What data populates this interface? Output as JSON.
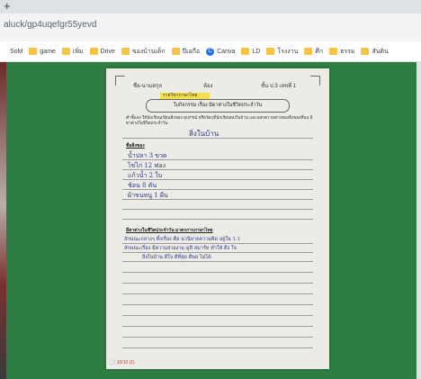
{
  "browser": {
    "new_tab_glyph": "+",
    "url": "aluck/gp4uqefgr55yevd",
    "bookmarks": [
      {
        "label": "SoM",
        "icon": "none"
      },
      {
        "label": "game",
        "icon": "folder-icon"
      },
      {
        "label": "เพิ่ม",
        "icon": "folder-icon"
      },
      {
        "label": "Drive",
        "icon": "folder-icon"
      },
      {
        "label": "ของบ้านเด็ก",
        "icon": "folder-icon"
      },
      {
        "label": "ปีเอกือ",
        "icon": "folder-icon"
      },
      {
        "label": "Canva",
        "icon": "canva-icon"
      },
      {
        "label": "LD",
        "icon": "folder-icon"
      },
      {
        "label": "โรงงาน",
        "icon": "folder-icon"
      },
      {
        "label": "ศึก",
        "icon": "folder-icon"
      },
      {
        "label": "ธรรม",
        "icon": "folder-icon"
      },
      {
        "label": "สันติน",
        "icon": "folder-icon"
      }
    ]
  },
  "worksheet": {
    "header_left": "ชื่อ-นามสกุล",
    "header_mid": "ห้อง",
    "header_right": "ชั้น ป.3 เลขที่ 1",
    "highlight": "รายวิชาภาษาไทย",
    "title": "ใบกิจกรรม เรื่อง มีดาต่างในชีวิตประจำวัน",
    "instruction": "คำชี้แจง ให้นักเรียนเขียนสิ่งของ อุปกรณ์ หรือวัตถุที่นักเรียนพบในบ้าน และบอกความต่างของสิ่งของที่พบ มีดาต่างในชีวิตประจำวัน",
    "handwritten_title": "สิ่งในบ้าน",
    "section1": "ชื่อสิ่งของ",
    "items": [
      "น้ำปลา 3 ขวด",
      "ไข่ไก่ 12 ฟอง",
      "แก้วน้ำ 2 ใบ",
      "ช้อน 8 คัน",
      "ผ้าขนหนู 1 ผืน"
    ],
    "section2": "มีดาต่างในชีวิตประจำวัน มาตรการภาษาไทย",
    "para_lines": [
      "ลักษณะกลางๆ ทั้งเรื่อง คือ นวนิยายความคิด อยู่ใน 1.1",
      "ลักษณะเรื่อง มีความสวยงาม ดูดี สมาร์ท ทำให้ ดึง ใจ",
      "สิ่งในบ้าน ดีใจ ดีที่สุด ดีพอ ไม่ได้"
    ],
    "footer": "🕑 10/10 (1)"
  }
}
